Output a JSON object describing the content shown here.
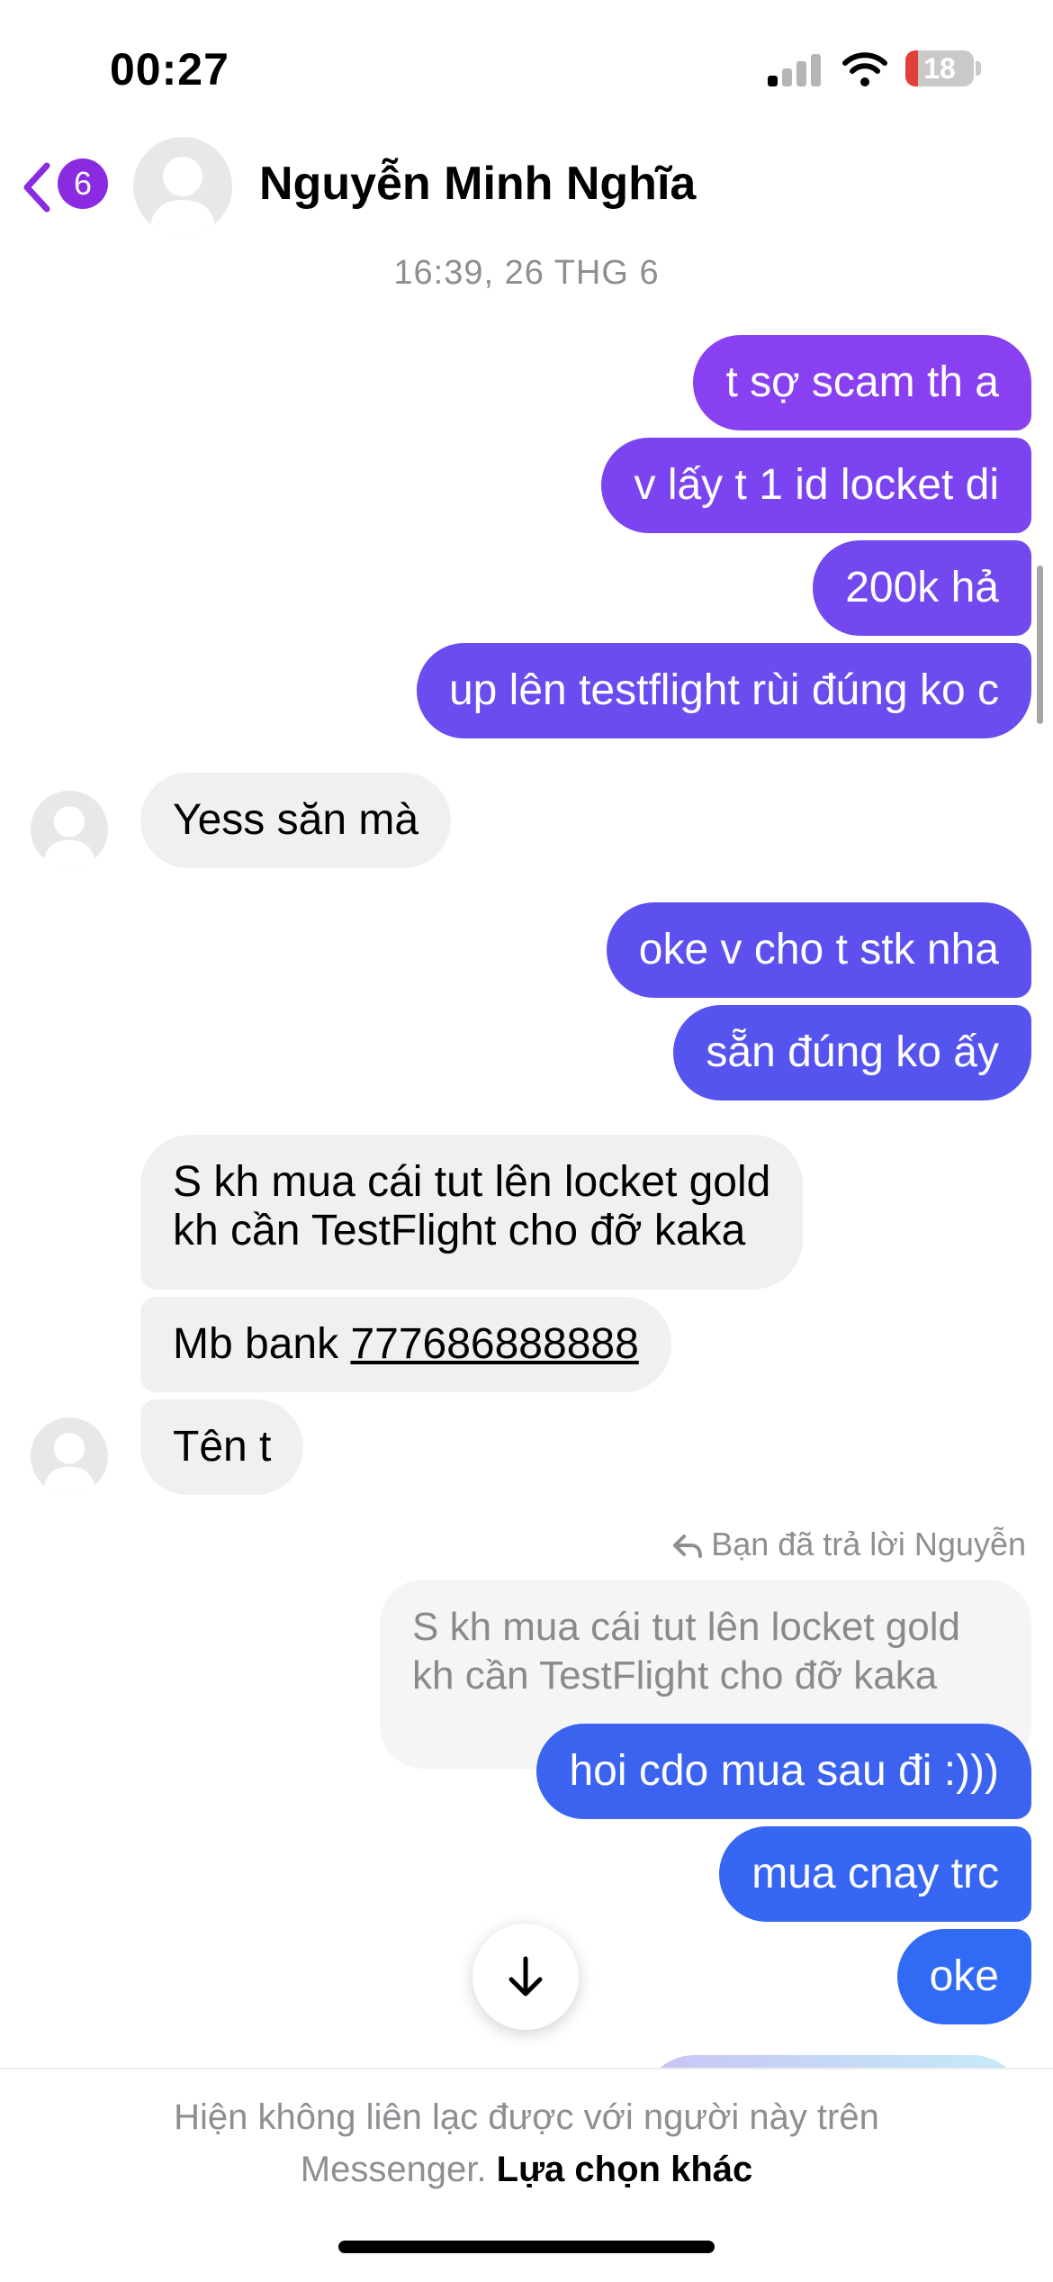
{
  "status_bar": {
    "time": "00:27",
    "battery": "18"
  },
  "header": {
    "back_badge": "6",
    "contact_name": "Nguyễn Minh Nghĩa"
  },
  "timestamp": "16:39, 26 THG 6",
  "messages": [
    {
      "dir": "out",
      "text": "t sợ scam th a"
    },
    {
      "dir": "out",
      "text": "v lấy t 1 id locket di"
    },
    {
      "dir": "out",
      "text": "200k hả"
    },
    {
      "dir": "out",
      "text": "up lên testflight rùi đúng ko c"
    },
    {
      "dir": "in",
      "text": "Yess săn mà"
    },
    {
      "dir": "out",
      "text": "oke v cho t stk nha"
    },
    {
      "dir": "out",
      "text": "sẵn đúng ko ấy"
    },
    {
      "dir": "in",
      "text": "S kh mua cái tut lên locket gold",
      "text2": "kh cần TestFlight cho đỡ kaka"
    },
    {
      "dir": "in",
      "text": "Mb bank ",
      "account": "777686888888"
    },
    {
      "dir": "in",
      "text": "Tên t"
    },
    {
      "dir": "out",
      "text": "hoi cdo mua sau đi :)))"
    },
    {
      "dir": "out",
      "text": "mua cnay trc"
    },
    {
      "dir": "out",
      "text": "oke"
    }
  ],
  "reply": {
    "label": "Bạn đã trả lời Nguyễn",
    "quoted_line1": "S kh mua cái tut lên locket gold",
    "quoted_line2": "kh cần TestFlight cho đỡ kaka"
  },
  "footer": {
    "line1": "Hiện không liên lạc được với người này trên",
    "line2_prefix": "Messenger.",
    "line2_link": "Lựa chọn khác"
  },
  "colors": {
    "out_gradient_top": "#8a3ff2",
    "out_gradient_bottom": "#2f6bf5",
    "incoming_bg": "#f0f0f0",
    "badge": "#8a2be2"
  }
}
